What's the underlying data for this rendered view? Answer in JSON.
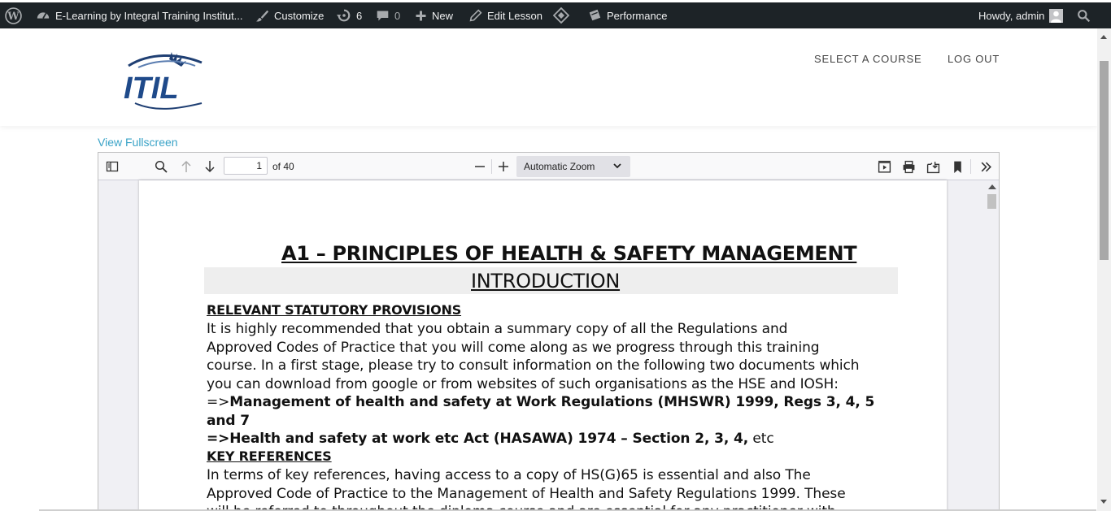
{
  "adminbar": {
    "site_name": "E-Learning by Integral Training Institut...",
    "customize": "Customize",
    "updates_count": "6",
    "comments_count": "0",
    "new": "New",
    "edit_lesson": "Edit Lesson",
    "performance": "Performance",
    "greeting": "Howdy, admin"
  },
  "header": {
    "logo_text": "ITIL",
    "nav": [
      "SELECT A COURSE",
      "LOG OUT"
    ]
  },
  "view_fullscreen": "View Fullscreen",
  "pdf": {
    "page_number": "1",
    "page_total": "of 40",
    "zoom": "Automatic Zoom",
    "document": {
      "title": "A1 – PRINCIPLES OF HEALTH & SAFETY MANAGEMENT",
      "intro": "INTRODUCTION",
      "section1_heading": "RELEVANT STATUTORY PROVISIONS",
      "section1_lines": [
        "It is highly recommended that you obtain a summary copy of all the Regulations and",
        "Approved Codes of Practice that you will come along as we progress through this training",
        "course. In a first stage, please try to consult information on the following two documents which",
        "you can download from google or from websites of such organisations as the HSE and IOSH:"
      ],
      "ref1_prefix": "=>",
      "ref1": "Management of health and safety at Work Regulations (MHSWR) 1999, Regs 3, 4, 5 and 7",
      "ref2": "=>Health and safety at work etc Act (HASAWA) 1974 – Section 2, 3, 4,",
      "ref2_suffix": " etc",
      "section2_heading": "KEY REFERENCES",
      "section2_lines": [
        "In terms of key references, having access to a copy of HS(G)65 is essential and also The",
        "Approved Code of Practice to the Management of Health and Safety Regulations 1999.  These",
        "will be referred to throughout the diploma course and are essential for any practitioner with"
      ]
    }
  }
}
